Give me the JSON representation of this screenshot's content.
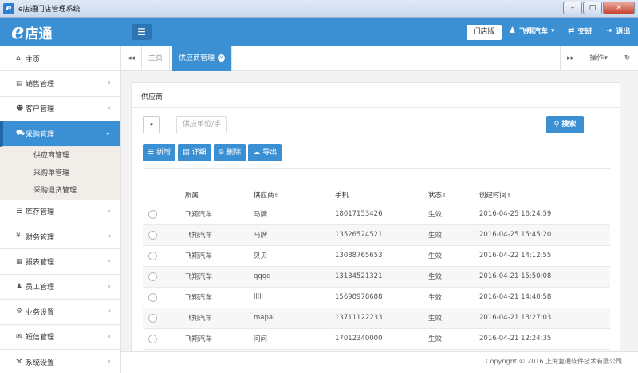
{
  "window": {
    "title": "e店通门店管理系统",
    "app_icon": "e",
    "minimize": "–",
    "maximize": "□",
    "close": "✕"
  },
  "header": {
    "logo_e": "e",
    "logo_text": "店通",
    "menu_icon": "☰",
    "store_button": "门店版",
    "user_label": "飞翔汽车",
    "shift_label": "交班",
    "logout_label": "退出",
    "accent_color": "#3b8fd3"
  },
  "sidebar": {
    "items": [
      {
        "label": "主页",
        "icon": "⌂",
        "chevron": ""
      },
      {
        "label": "销售管理",
        "icon": "▤",
        "chevron": "‹"
      },
      {
        "label": "客户管理",
        "icon": "☻",
        "chevron": "‹"
      },
      {
        "label": "采购管理",
        "icon": "⛟",
        "chevron": "⌄"
      },
      {
        "label": "库存管理",
        "icon": "☰",
        "chevron": "‹"
      },
      {
        "label": "财务管理",
        "icon": "¥",
        "chevron": "‹"
      },
      {
        "label": "报表管理",
        "icon": "▦",
        "chevron": "‹"
      },
      {
        "label": "员工管理",
        "icon": "♟",
        "chevron": "‹"
      },
      {
        "label": "业务设置",
        "icon": "⚙",
        "chevron": "‹"
      },
      {
        "label": "短信管理",
        "icon": "✉",
        "chevron": "‹"
      },
      {
        "label": "系统设置",
        "icon": "⚒",
        "chevron": "‹"
      }
    ],
    "sub_items": [
      "供应商管理",
      "采购单管理",
      "采购退货管理"
    ]
  },
  "tabs": {
    "prev": "◂◂",
    "next": "▸▸",
    "home": "主页",
    "active": "供应商管理",
    "close": "×",
    "actions": "操作▾",
    "refresh": "↻"
  },
  "panel": {
    "title": "供应商",
    "select_value": "▾",
    "search_placeholder": "供应单位/手",
    "search_button": "搜索"
  },
  "toolbar": [
    {
      "label": "新增",
      "icon": "☰"
    },
    {
      "label": "详细",
      "icon": "▤"
    },
    {
      "label": "删除",
      "icon": "⊖"
    },
    {
      "label": "导出",
      "icon": "☁"
    }
  ],
  "table": {
    "headers": [
      "",
      "所属",
      "供应商",
      "手机",
      "状态",
      "创建时间"
    ],
    "sort_icon": "⇕",
    "rows": [
      [
        "飞翔汽车",
        "马牌",
        "18017153426",
        "生效",
        "2016-04-25 16:24:59"
      ],
      [
        "飞翔汽车",
        "马牌",
        "13526524521",
        "生效",
        "2016-04-25 15:45:20"
      ],
      [
        "飞翔汽车",
        "贝贝",
        "13088765653",
        "生效",
        "2016-04-22 14:12:55"
      ],
      [
        "飞翔汽车",
        "qqqq",
        "13134521321",
        "生效",
        "2016-04-21 15:50:08"
      ],
      [
        "飞翔汽车",
        "lllll",
        "15698978688",
        "生效",
        "2016-04-21 14:40:58"
      ],
      [
        "飞翔汽车",
        "mapai",
        "13711122233",
        "生效",
        "2016-04-21 13:27:03"
      ],
      [
        "飞翔汽车",
        "问问",
        "17012340000",
        "生效",
        "2016-04-21 12:24:35"
      ]
    ]
  },
  "footer": {
    "copyright": "Copyright © 2016 上海复通软件技术有限公司"
  }
}
